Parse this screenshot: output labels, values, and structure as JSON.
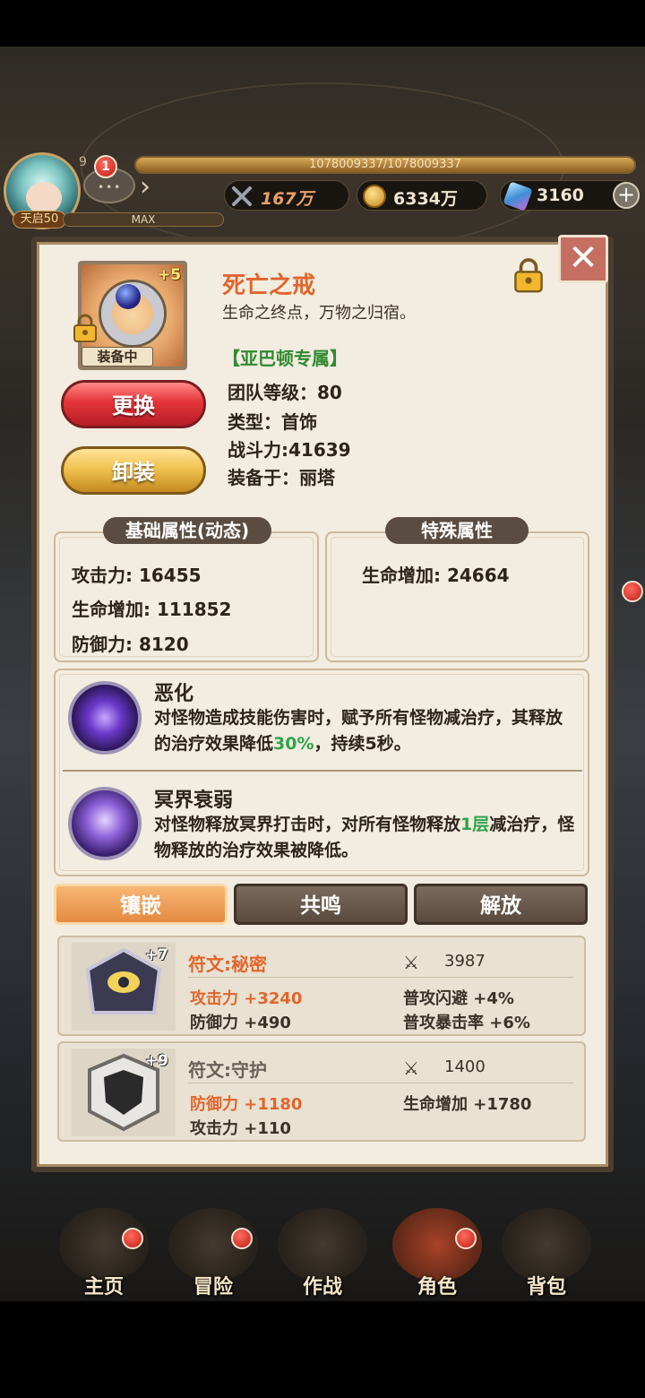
{
  "hud": {
    "vip_level": "9",
    "chat_badge": "1",
    "exp_text": "1078009337/1078009337",
    "exp_progress": 1.0,
    "max_label": "MAX",
    "level_tag": "天启50",
    "power_value": "167万",
    "gold_value": "6334万",
    "gem_value": "3160",
    "plus": "+"
  },
  "item": {
    "name": "死亡之戒",
    "description": "生命之终点，万物之归宿。",
    "plus_level": "+5",
    "equipped_tag": "装备中",
    "exclusive": "【亚巴顿专属】",
    "team_level": "团队等级：80",
    "type": "类型：首饰",
    "combat_power": "战斗力:41639",
    "equipped_by": "装备于：丽塔",
    "replace_button": "更换",
    "unequip_button": "卸装",
    "close_symbol": "✕"
  },
  "base_attrs": {
    "title": "基础属性(动态)",
    "lines": [
      "攻击力: 16455",
      "生命增加: 111852",
      "防御力: 8120"
    ]
  },
  "special_attrs": {
    "title": "特殊属性",
    "lines": [
      "生命增加: 24664"
    ]
  },
  "skills": [
    {
      "name": "恶化",
      "desc_pre": "对怪物造成技能伤害时，赋予所有怪物减治疗，其释放的治疗效果降低",
      "highlight": "30%",
      "desc_post": "，持续5秒。"
    },
    {
      "name": "冥界衰弱",
      "desc_pre": "对怪物释放冥界打击时，对所有怪物释放",
      "highlight": "1层",
      "desc_post": "减治疗，怪物释放的治疗效果被降低。"
    }
  ],
  "tabs": [
    "镶嵌",
    "共鸣",
    "解放"
  ],
  "runes": [
    {
      "plus": "+7",
      "name": "符文:秘密",
      "power": "3987",
      "stats": [
        "攻击力 +3240",
        "防御力 +490",
        "普攻闪避 +4%",
        "普攻暴击率 +6%"
      ]
    },
    {
      "plus": "+9",
      "name": "符文:守护",
      "power": "1400",
      "stats": [
        "防御力 +1180",
        "攻击力 +110",
        "生命增加 +1780"
      ]
    }
  ],
  "bottom_nav": [
    "主页",
    "冒险",
    "作战",
    "角色",
    "背包"
  ],
  "colors": {
    "accent_orange": "#e0662d",
    "exclusive_green": "#2f8a30",
    "highlight_green": "#30a34a",
    "panel_bg": "#f3ece0"
  }
}
